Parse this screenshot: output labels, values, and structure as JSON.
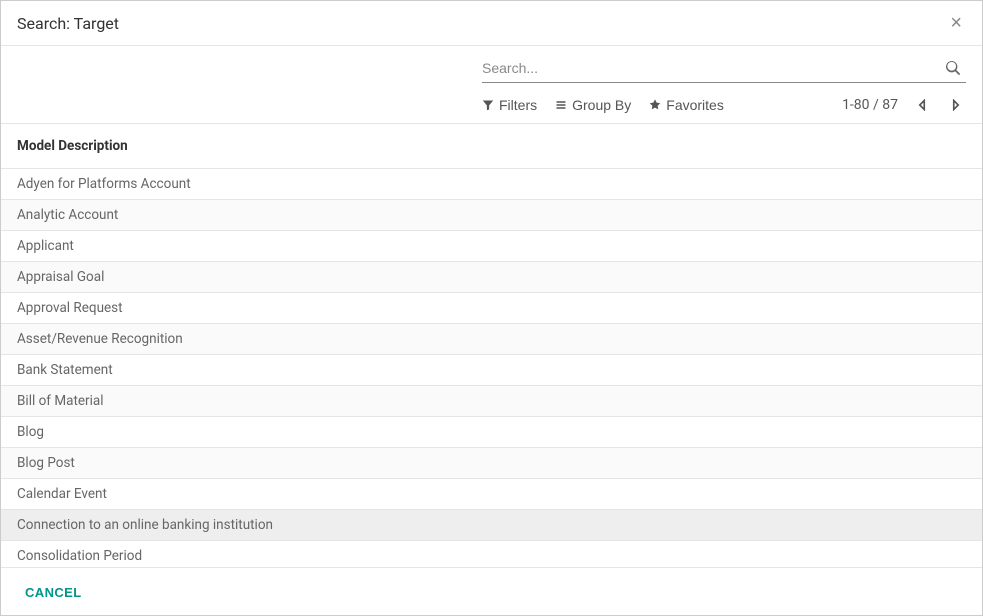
{
  "header": {
    "title": "Search: Target"
  },
  "search": {
    "placeholder": "Search..."
  },
  "controls": {
    "filters": "Filters",
    "groupby": "Group By",
    "favorites": "Favorites"
  },
  "pager": {
    "text": "1-80 / 87"
  },
  "list": {
    "column_header": "Model Description",
    "rows": [
      "Adyen for Platforms Account",
      "Analytic Account",
      "Applicant",
      "Appraisal Goal",
      "Approval Request",
      "Asset/Revenue Recognition",
      "Bank Statement",
      "Bill of Material",
      "Blog",
      "Blog Post",
      "Calendar Event",
      "Connection to an online banking institution",
      "Consolidation Period"
    ],
    "hovered_index": 11
  },
  "footer": {
    "cancel": "CANCEL"
  }
}
